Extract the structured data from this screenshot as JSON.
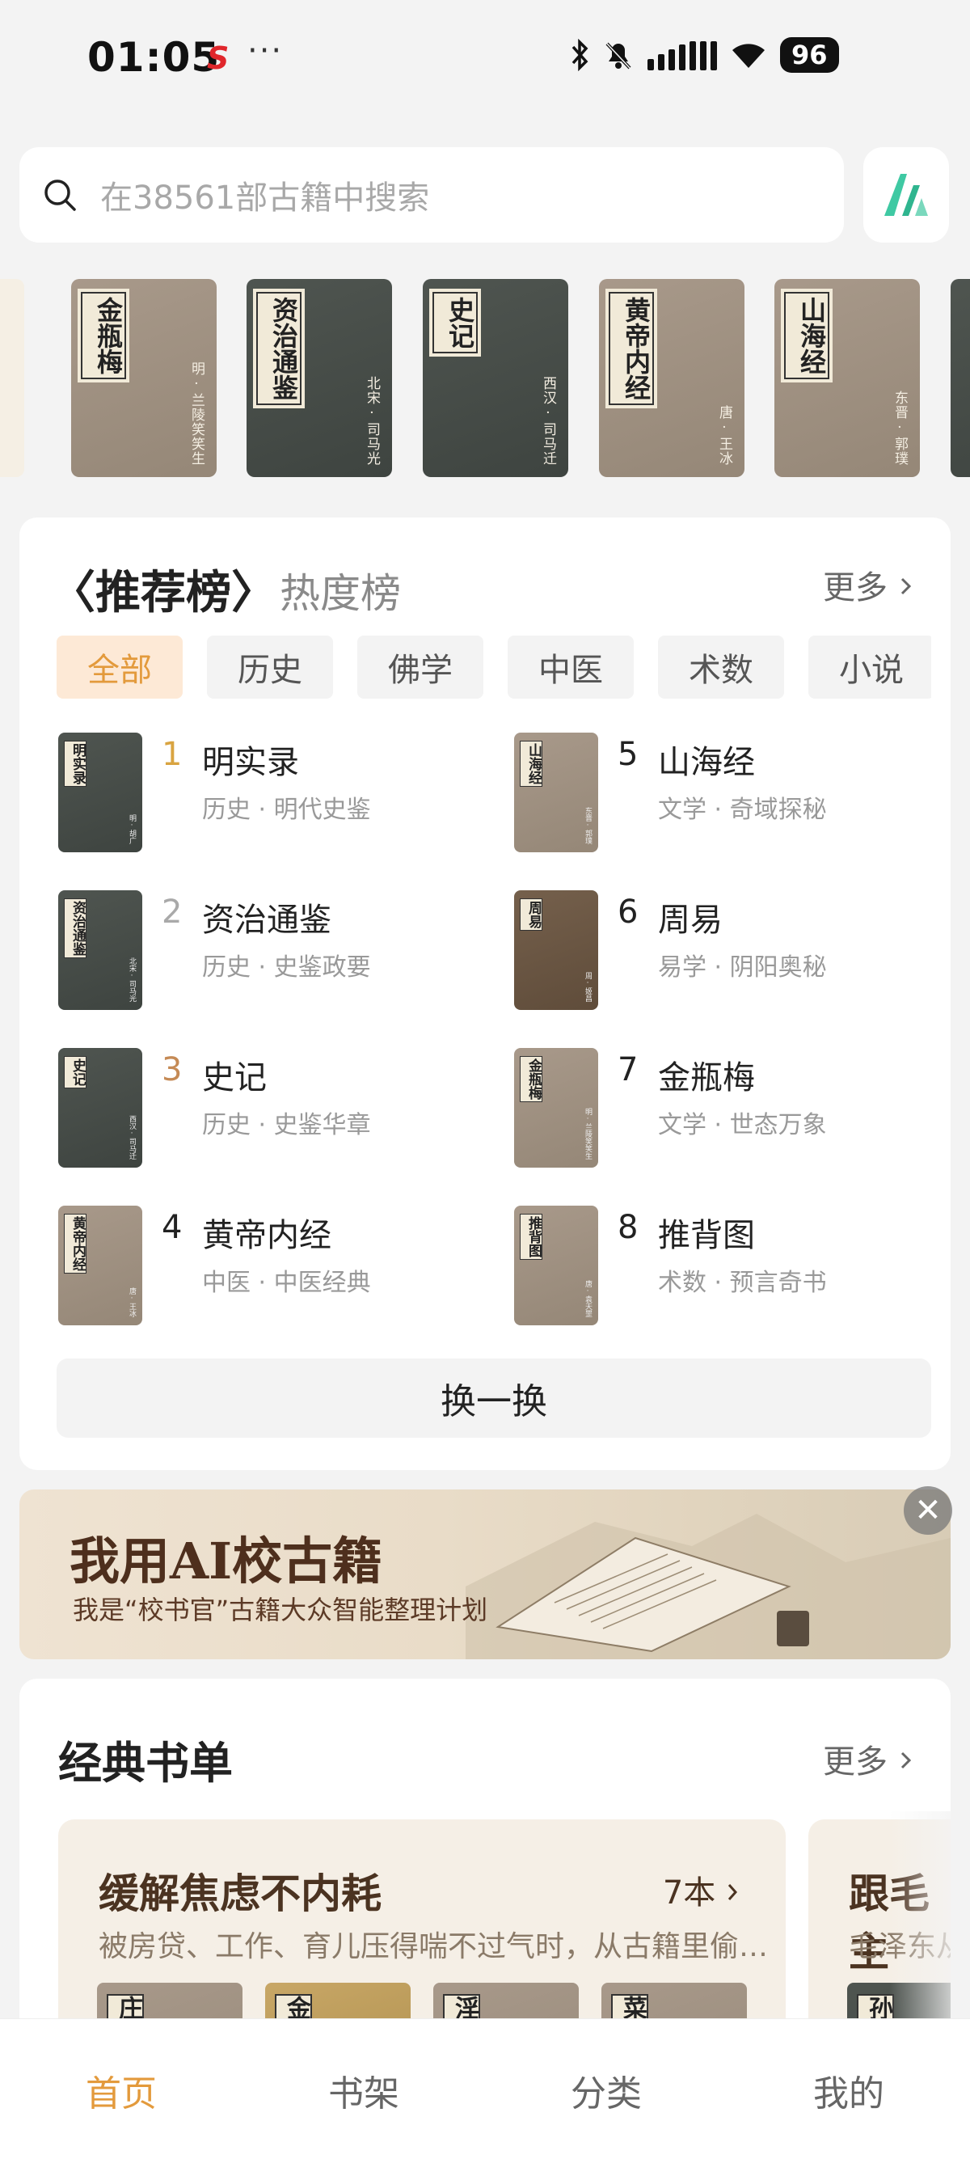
{
  "status_bar": {
    "time": "01:05",
    "app_icon": "S",
    "dots": "···",
    "battery": "96"
  },
  "search": {
    "placeholder": "在38561部古籍中搜索"
  },
  "cover_strip": [
    {
      "title": "金瓶梅",
      "author": "明·兰陵笑笑生",
      "tone": "tan"
    },
    {
      "title": "资治通鉴",
      "author": "北宋·司马光",
      "tone": "gray"
    },
    {
      "title": "史记",
      "author": "西汉·司马迁",
      "tone": "gray"
    },
    {
      "title": "黄帝内经",
      "author": "唐·王冰",
      "tone": "tan"
    },
    {
      "title": "山海经",
      "author": "东晋·郭璞",
      "tone": "tan"
    }
  ],
  "ranking": {
    "tab_active": "〈推荐榜〉",
    "tab_other": "热度榜",
    "more": "更多",
    "chips": [
      "全部",
      "历史",
      "佛学",
      "中医",
      "术数",
      "小说"
    ],
    "items": [
      {
        "rank": "1",
        "title": "明实录",
        "meta": "历史 · 明代史鉴",
        "cover": "明实录",
        "author": "明·胡广",
        "tone": "gray",
        "rank_color": "#d9a441"
      },
      {
        "rank": "2",
        "title": "资治通鉴",
        "meta": "历史 · 史鉴政要",
        "cover": "资治通鉴",
        "author": "北宋·司马光",
        "tone": "gray",
        "rank_color": "#a9a9a9"
      },
      {
        "rank": "3",
        "title": "史记",
        "meta": "历史 · 史鉴华章",
        "cover": "史记",
        "author": "西汉·司马迁",
        "tone": "gray",
        "rank_color": "#c58a55"
      },
      {
        "rank": "4",
        "title": "黄帝内经",
        "meta": "中医 · 中医经典",
        "cover": "黄帝内经",
        "author": "唐·王冰",
        "tone": "tan",
        "rank_color": "#222222"
      },
      {
        "rank": "5",
        "title": "山海经",
        "meta": "文学 · 奇域探秘",
        "cover": "山海经",
        "author": "东晋·郭璞",
        "tone": "tan",
        "rank_color": "#222222"
      },
      {
        "rank": "6",
        "title": "周易",
        "meta": "易学 · 阴阳奥秘",
        "cover": "周易",
        "author": "周·姬昌",
        "tone": "brown",
        "rank_color": "#222222"
      },
      {
        "rank": "7",
        "title": "金瓶梅",
        "meta": "文学 · 世态万象",
        "cover": "金瓶梅",
        "author": "明·兰陵笑笑生",
        "tone": "tan",
        "rank_color": "#222222"
      },
      {
        "rank": "8",
        "title": "推背图",
        "meta": "术数 · 预言奇书",
        "cover": "推背图",
        "author": "唐·袁天罡",
        "tone": "tan",
        "rank_color": "#222222"
      }
    ],
    "refresh": "换一换"
  },
  "banner": {
    "title": "我用AI校古籍",
    "subtitle": "我是“校书官”古籍大众智能整理计划",
    "close": "✕"
  },
  "booklists": {
    "title": "经典书单",
    "more": "更多",
    "lists": [
      {
        "title": "缓解焦虑不内耗",
        "count": "7本",
        "desc": "被房贷、工作、育儿压得喘不过气时，从古籍里偷…",
        "minis": [
          "庄",
          "金",
          "淫",
          "菜"
        ]
      },
      {
        "title": "跟毛主",
        "count": "",
        "desc": "毛泽东从",
        "minis": [
          "孙"
        ]
      }
    ]
  },
  "nav": [
    "首页",
    "书架",
    "分类",
    "我的"
  ],
  "colors": {
    "accent": "#e39a3c",
    "banner_text": "#4e2f1d"
  }
}
